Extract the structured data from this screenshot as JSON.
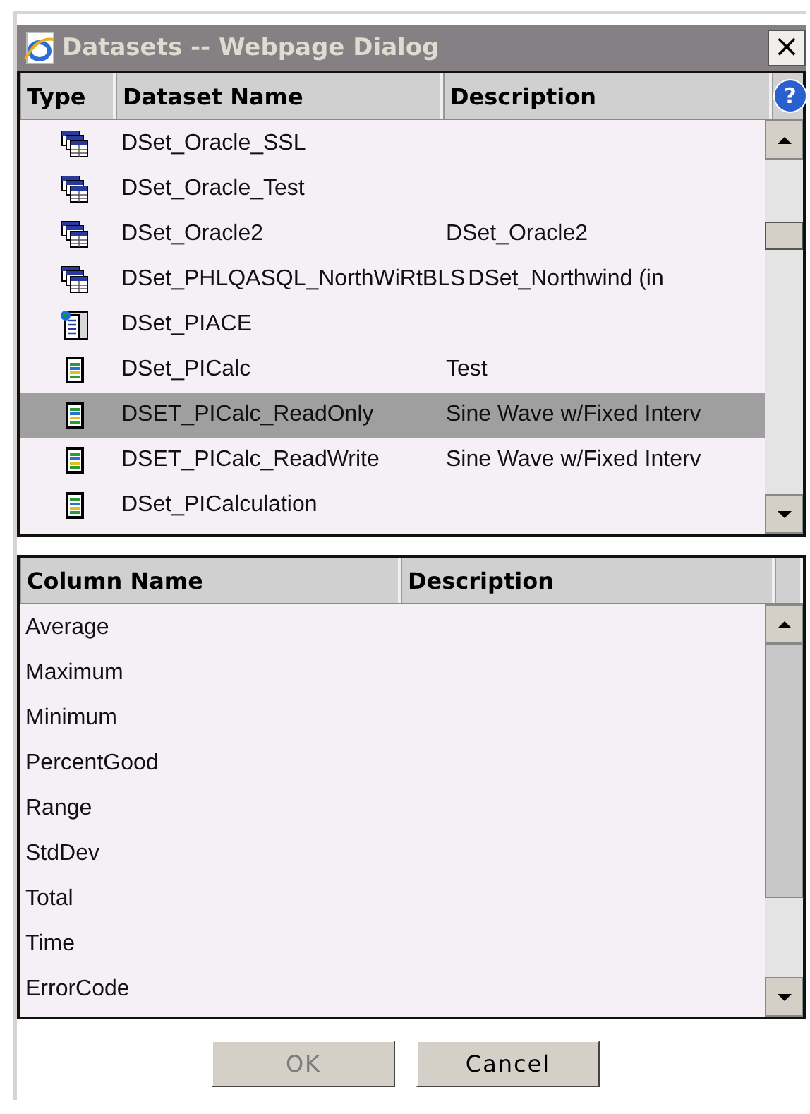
{
  "window": {
    "title": "Datasets -- Webpage Dialog",
    "close": "×"
  },
  "datasets": {
    "columns": [
      "Type",
      "Dataset Name",
      "Description"
    ],
    "help": "?",
    "rows": [
      {
        "kind": "relational",
        "name": "DSet_Oracle_SSL",
        "description": "",
        "selected": false
      },
      {
        "kind": "relational",
        "name": "DSet_Oracle_Test",
        "description": "",
        "selected": false
      },
      {
        "kind": "relational",
        "name": "DSet_Oracle2",
        "description": "DSet_Oracle2",
        "selected": false
      },
      {
        "kind": "relational",
        "name": "DSet_PHLQASQL_NorthWiRtBLS",
        "description": "DSet_Northwind (in",
        "selected": false
      },
      {
        "kind": "ace",
        "name": "DSet_PIACE",
        "description": "",
        "selected": false
      },
      {
        "kind": "calc",
        "name": "DSet_PICalc",
        "description": "Test",
        "selected": false
      },
      {
        "kind": "calc",
        "name": "DSET_PICalc_ReadOnly",
        "description": "Sine Wave w/Fixed Interv",
        "selected": true
      },
      {
        "kind": "calc",
        "name": "DSET_PICalc_ReadWrite",
        "description": "Sine Wave w/Fixed Interv",
        "selected": false
      },
      {
        "kind": "calc",
        "name": "DSet_PICalculation",
        "description": "",
        "selected": false
      }
    ]
  },
  "columns_table": {
    "columns": [
      "Column Name",
      "Description"
    ],
    "rows": [
      {
        "name": "Average"
      },
      {
        "name": "Maximum"
      },
      {
        "name": "Minimum"
      },
      {
        "name": "PercentGood"
      },
      {
        "name": "Range"
      },
      {
        "name": "StdDev"
      },
      {
        "name": "Total"
      },
      {
        "name": "Time"
      },
      {
        "name": "ErrorCode"
      }
    ]
  },
  "buttons": [
    {
      "label": "OK",
      "disabled": true
    },
    {
      "label": "Cancel",
      "disabled": false
    }
  ]
}
